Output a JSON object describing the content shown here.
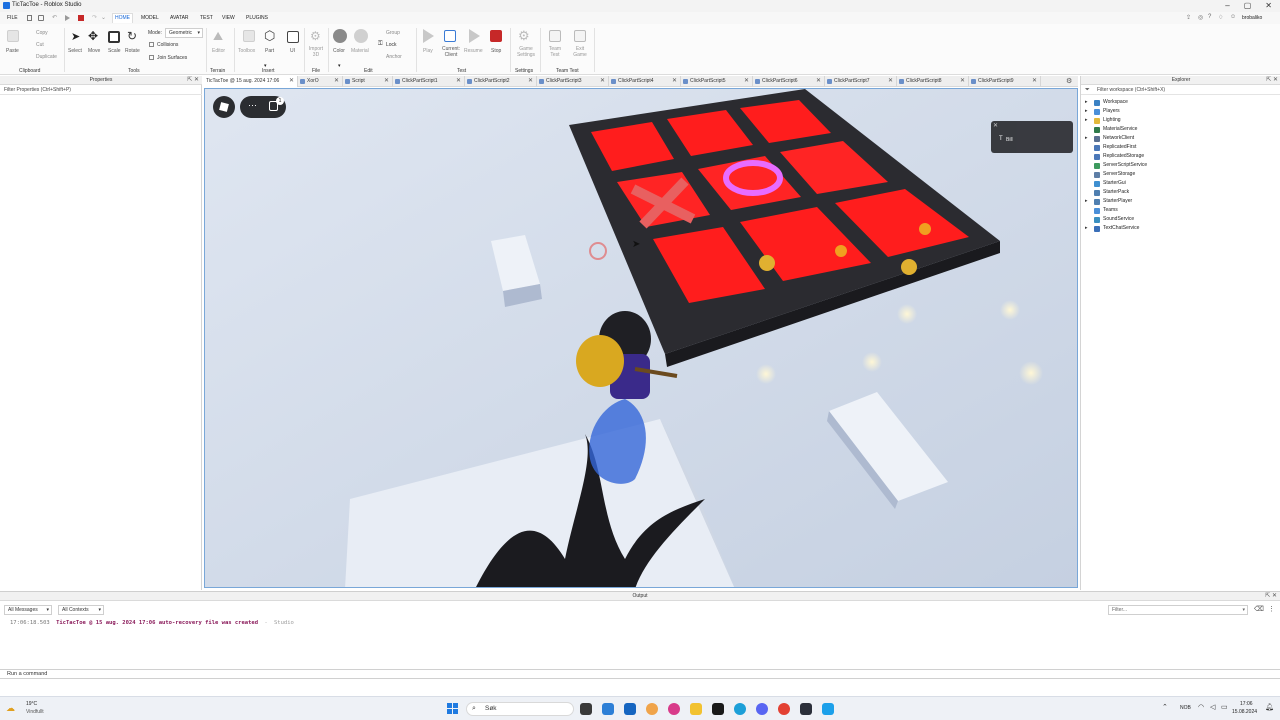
{
  "window": {
    "title": "TicTacToe - Roblox Studio",
    "controls": [
      "–",
      "▢",
      "✕"
    ]
  },
  "menubar": {
    "items": [
      "FILE",
      "HOME",
      "MODEL",
      "AVATAR",
      "TEST",
      "VIEW",
      "PLUGINS"
    ],
    "active": "HOME",
    "username": "brobaliko"
  },
  "ribbon": {
    "clipboard": {
      "paste": "Paste",
      "copy": "Copy",
      "cut": "Cut",
      "duplicate": "Duplicate",
      "section": "Clipboard"
    },
    "tools": {
      "select": "Select",
      "move": "Move",
      "scale": "Scale",
      "rotate": "Rotate",
      "mode_label": "Mode:",
      "mode_value": "Geometric",
      "collisions": "Collisions",
      "join_surfaces": "Join Surfaces",
      "section": "Tools"
    },
    "terrain": {
      "editor": "Editor",
      "section": "Terrain"
    },
    "insert": {
      "toolbox": "Toolbox",
      "part": "Part",
      "ui": "UI",
      "section": "Insert"
    },
    "file": {
      "import3d": "Import 3D",
      "section": "File"
    },
    "edit": {
      "color": "Color",
      "material": "Material",
      "group": "Group",
      "lock": "Lock",
      "anchor": "Anchor",
      "section": "Edit"
    },
    "test": {
      "play": "Play",
      "current_client": "Current: Client",
      "resume": "Resume",
      "stop": "Stop",
      "section": "Test"
    },
    "settings": {
      "game_settings": "Game Settings",
      "section": "Settings"
    },
    "team_test": {
      "team_test": "Team Test",
      "exit_game": "Exit Game",
      "section": "Team Test"
    }
  },
  "properties": {
    "title": "Properties",
    "filter": "Filter Properties (Ctrl+Shift+P)"
  },
  "tabs": [
    {
      "label": "TicTacToe @ 15 aug. 2024 17:06",
      "active": true
    },
    {
      "label": "XorO"
    },
    {
      "label": "Script"
    },
    {
      "label": "ClickPartScript1"
    },
    {
      "label": "ClickPartScript2"
    },
    {
      "label": "ClickPartScript3"
    },
    {
      "label": "ClickPartScript4"
    },
    {
      "label": "ClickPartScript5"
    },
    {
      "label": "ClickPartScript6"
    },
    {
      "label": "ClickPartScript7"
    },
    {
      "label": "ClickPartScript8"
    },
    {
      "label": "ClickPartScript9"
    }
  ],
  "viewport": {
    "player_tag": "Bill",
    "chat_badge": "1",
    "board_cells": [
      "",
      "",
      "",
      "X",
      "O",
      "",
      "",
      "",
      ""
    ]
  },
  "explorer": {
    "title": "Explorer",
    "filter": "Filter workspace (Ctrl+Shift+X)",
    "items": [
      {
        "label": "Workspace",
        "expandable": true,
        "icon_color": "#3b82c4"
      },
      {
        "label": "Players",
        "expandable": true,
        "icon_color": "#4a8fd8"
      },
      {
        "label": "Lighting",
        "expandable": true,
        "icon_color": "#e2b93b"
      },
      {
        "label": "MaterialService",
        "expandable": false,
        "icon_color": "#2f7a4a"
      },
      {
        "label": "NetworkClient",
        "expandable": true,
        "icon_color": "#5a6f90"
      },
      {
        "label": "ReplicatedFirst",
        "expandable": false,
        "icon_color": "#4b78b8"
      },
      {
        "label": "ReplicatedStorage",
        "expandable": false,
        "icon_color": "#4b78b8"
      },
      {
        "label": "ServerScriptService",
        "expandable": false,
        "icon_color": "#3d9a5e"
      },
      {
        "label": "ServerStorage",
        "expandable": false,
        "icon_color": "#5e7ea6"
      },
      {
        "label": "StarterGui",
        "expandable": false,
        "icon_color": "#3f8fd0"
      },
      {
        "label": "StarterPack",
        "expandable": false,
        "icon_color": "#4f7fb0"
      },
      {
        "label": "StarterPlayer",
        "expandable": true,
        "icon_color": "#4f7fb0"
      },
      {
        "label": "Teams",
        "expandable": false,
        "icon_color": "#4a8fd8"
      },
      {
        "label": "SoundService",
        "expandable": false,
        "icon_color": "#3a8fc0"
      },
      {
        "label": "TextChatService",
        "expandable": true,
        "icon_color": "#3a6fb8"
      }
    ]
  },
  "output": {
    "title": "Output",
    "filter_messages": "All Messages",
    "filter_contexts": "All Contexts",
    "filter_placeholder": "Filter...",
    "lines": [
      {
        "time": "17:06:18.503",
        "text": "TicTacToe @ 15 aug. 2024 17:06 auto-recovery file was created",
        "source": "Studio"
      }
    ]
  },
  "command_bar": {
    "placeholder": "Run a command"
  },
  "taskbar": {
    "weather_temp": "19°C",
    "weather_desc": "Vindfullt",
    "search_label": "Søk",
    "lang": "NOB",
    "time": "17:06",
    "date": "15.08.2024"
  },
  "colors": {
    "accent": "#1667d8",
    "board_red": "#ff1d1d",
    "stop_red": "#c62828",
    "selection_blue": "#79a7d8"
  }
}
